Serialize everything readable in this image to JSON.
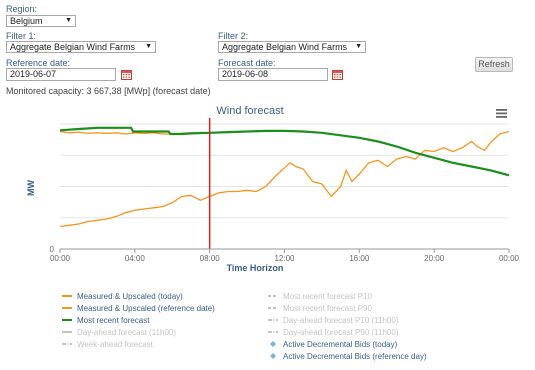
{
  "filters": {
    "region_label": "Region:",
    "region_value": "Belgium",
    "filter1_label": "Filter 1:",
    "filter1_value": "Aggregate Belgian Wind Farms",
    "filter2_label": "Filter 2:",
    "filter2_value": "Aggregate Belgian Wind Farms",
    "ref_date_label": "Reference date:",
    "ref_date_value": "2019-06-07",
    "forecast_date_label": "Forecast date:",
    "forecast_date_value": "2019-06-08",
    "refresh_label": "Refresh",
    "monitored_capacity": "Monitored capacity: 3 667,38 [MWp] (forecast date)"
  },
  "icons": {
    "dropdown": "chevron-down-icon",
    "calendar": "calendar-icon",
    "menu": "hamburger-menu-icon"
  },
  "colors": {
    "orange": "#f7941e",
    "green": "#1a8f1a",
    "red": "#e02020",
    "label_blue": "#3a5e86",
    "axis_text": "#666666",
    "disabled": "#c4c4c4",
    "diamond": "#7fb3d5"
  },
  "chart_data": {
    "type": "line",
    "title": "Wind forecast",
    "xlabel": "Time Horizon",
    "ylabel": "MW",
    "x_ticks": [
      "00:00",
      "04:00",
      "08:00",
      "12:00",
      "16:00",
      "20:00",
      "00:00"
    ],
    "y_ticks": [
      "0"
    ],
    "xlim": [
      0,
      24
    ],
    "ylim": [
      0,
      10
    ],
    "vertical_marker": {
      "x": 8,
      "color": "#e02020"
    },
    "grid": true,
    "legend": "bottom",
    "series": [
      {
        "name": "Measured & Upscaled (today)",
        "color": "#f7941e",
        "points": [
          [
            0,
            1.8
          ],
          [
            0.5,
            1.9
          ],
          [
            1,
            2.0
          ],
          [
            1.5,
            2.2
          ],
          [
            2,
            2.3
          ],
          [
            2.5,
            2.4
          ],
          [
            3,
            2.6
          ],
          [
            3.5,
            2.9
          ],
          [
            4,
            3.1
          ],
          [
            4.5,
            3.2
          ],
          [
            5,
            3.3
          ],
          [
            5.5,
            3.4
          ],
          [
            6,
            3.7
          ],
          [
            6.5,
            4.2
          ],
          [
            7,
            4.3
          ],
          [
            7.5,
            3.9
          ],
          [
            8,
            4.2
          ],
          [
            8.5,
            4.5
          ],
          [
            9,
            4.6
          ],
          [
            9.5,
            4.6
          ],
          [
            10,
            4.7
          ],
          [
            10.5,
            4.6
          ],
          [
            11,
            5.0
          ],
          [
            11.5,
            5.8
          ],
          [
            12,
            6.5
          ],
          [
            12.3,
            6.9
          ],
          [
            12.6,
            6.6
          ],
          [
            13,
            6.4
          ],
          [
            13.5,
            5.4
          ],
          [
            14,
            5.2
          ],
          [
            14.5,
            4.2
          ],
          [
            15,
            5.0
          ],
          [
            15.3,
            6.3
          ],
          [
            15.6,
            5.4
          ],
          [
            16,
            6.0
          ],
          [
            16.5,
            6.9
          ],
          [
            17,
            7.1
          ],
          [
            17.5,
            6.6
          ],
          [
            18,
            7.2
          ],
          [
            18.5,
            7.4
          ],
          [
            19,
            7.2
          ],
          [
            19.5,
            7.9
          ],
          [
            20,
            7.8
          ],
          [
            20.5,
            8.1
          ],
          [
            21,
            7.8
          ],
          [
            21.5,
            8.1
          ],
          [
            22,
            8.6
          ],
          [
            22.3,
            8.2
          ],
          [
            22.7,
            7.9
          ],
          [
            23,
            8.5
          ],
          [
            23.5,
            9.2
          ],
          [
            24,
            9.4
          ]
        ]
      },
      {
        "name": "Measured & Upscaled (reference date)",
        "color": "#f7941e",
        "points": [
          [
            0,
            9.4
          ],
          [
            0.5,
            9.3
          ],
          [
            1,
            9.35
          ],
          [
            1.5,
            9.25
          ],
          [
            2,
            9.3
          ],
          [
            2.5,
            9.25
          ],
          [
            3,
            9.3
          ],
          [
            3.5,
            9.2
          ],
          [
            4,
            9.3
          ],
          [
            4.5,
            9.25
          ],
          [
            5,
            9.3
          ],
          [
            5.5,
            9.2
          ],
          [
            6,
            9.2
          ],
          [
            6.5,
            9.25
          ],
          [
            7,
            9.3
          ],
          [
            7.5,
            9.25
          ],
          [
            8,
            9.3
          ]
        ]
      },
      {
        "name": "Most recent forecast",
        "color": "#1a8f1a",
        "points": [
          [
            0,
            9.5
          ],
          [
            1,
            9.6
          ],
          [
            2,
            9.7
          ],
          [
            3,
            9.7
          ],
          [
            3.8,
            9.7
          ],
          [
            3.9,
            9.4
          ],
          [
            4.5,
            9.4
          ],
          [
            5,
            9.4
          ],
          [
            5.8,
            9.4
          ],
          [
            5.9,
            9.2
          ],
          [
            6.5,
            9.2
          ],
          [
            7,
            9.25
          ],
          [
            8,
            9.3
          ],
          [
            9,
            9.35
          ],
          [
            10,
            9.4
          ],
          [
            11,
            9.45
          ],
          [
            12,
            9.45
          ],
          [
            13,
            9.4
          ],
          [
            14,
            9.3
          ],
          [
            15,
            9.1
          ],
          [
            16,
            8.9
          ],
          [
            17,
            8.6
          ],
          [
            18,
            8.2
          ],
          [
            19,
            7.7
          ],
          [
            20,
            7.3
          ],
          [
            21,
            6.9
          ],
          [
            22,
            6.6
          ],
          [
            23,
            6.3
          ],
          [
            24,
            5.9
          ]
        ]
      }
    ],
    "legend_items": [
      {
        "label": "Measured & Upscaled (today)",
        "color": "#f7941e",
        "style": "solid",
        "enabled": true
      },
      {
        "label": "Measured & Upscaled (reference date)",
        "color": "#f7941e",
        "style": "solid",
        "enabled": true
      },
      {
        "label": "Most recent forecast",
        "color": "#1a8f1a",
        "style": "solid",
        "enabled": true
      },
      {
        "label": "Day-ahead forecast (11h00)",
        "color": "#c4c4c4",
        "style": "solid",
        "enabled": false
      },
      {
        "label": "Week-ahead forecast",
        "color": "#c4c4c4",
        "style": "dashdot",
        "enabled": false
      },
      {
        "label": "Most recent forecast P10",
        "color": "#c4c4c4",
        "style": "dash",
        "enabled": false
      },
      {
        "label": "Most recent forecast P90",
        "color": "#c4c4c4",
        "style": "dash",
        "enabled": false
      },
      {
        "label": "Day-ahead forecast P10 (11h00)",
        "color": "#c4c4c4",
        "style": "dashdot",
        "enabled": false
      },
      {
        "label": "Day-ahead forecast P90 (11h00)",
        "color": "#c4c4c4",
        "style": "dashdot",
        "enabled": false
      },
      {
        "label": "Active Decremental Bids (today)",
        "color": "#7fb3d5",
        "style": "diamond",
        "enabled": true
      },
      {
        "label": "Active Decremental Bids (reference day)",
        "color": "#7fb3d5",
        "style": "diamond",
        "enabled": true
      }
    ]
  }
}
